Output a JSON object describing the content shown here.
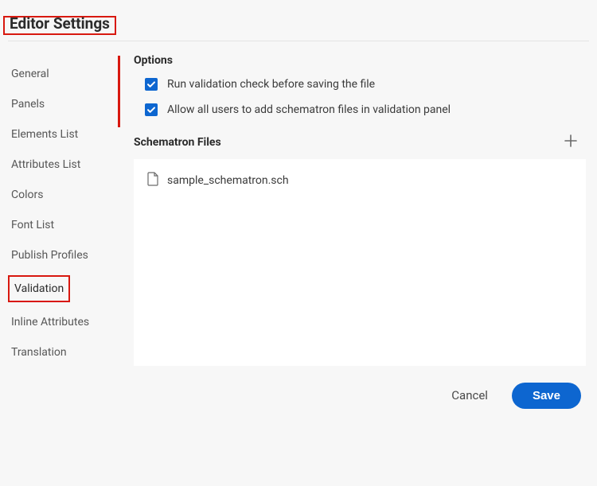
{
  "header": {
    "title": "Editor Settings"
  },
  "sidebar": {
    "items": [
      {
        "label": "General",
        "active": false
      },
      {
        "label": "Panels",
        "active": false
      },
      {
        "label": "Elements List",
        "active": false
      },
      {
        "label": "Attributes List",
        "active": false
      },
      {
        "label": "Colors",
        "active": false
      },
      {
        "label": "Font List",
        "active": false
      },
      {
        "label": "Publish Profiles",
        "active": false
      },
      {
        "label": "Validation",
        "active": true
      },
      {
        "label": "Inline Attributes",
        "active": false
      },
      {
        "label": "Translation",
        "active": false
      }
    ]
  },
  "main": {
    "options_title": "Options",
    "options": [
      {
        "label": "Run validation check before saving the file",
        "checked": true
      },
      {
        "label": "Allow all users to add schematron files in validation panel",
        "checked": true
      }
    ],
    "schematron_title": "Schematron Files",
    "files": [
      {
        "name": "sample_schematron.sch"
      }
    ]
  },
  "footer": {
    "cancel_label": "Cancel",
    "save_label": "Save"
  }
}
